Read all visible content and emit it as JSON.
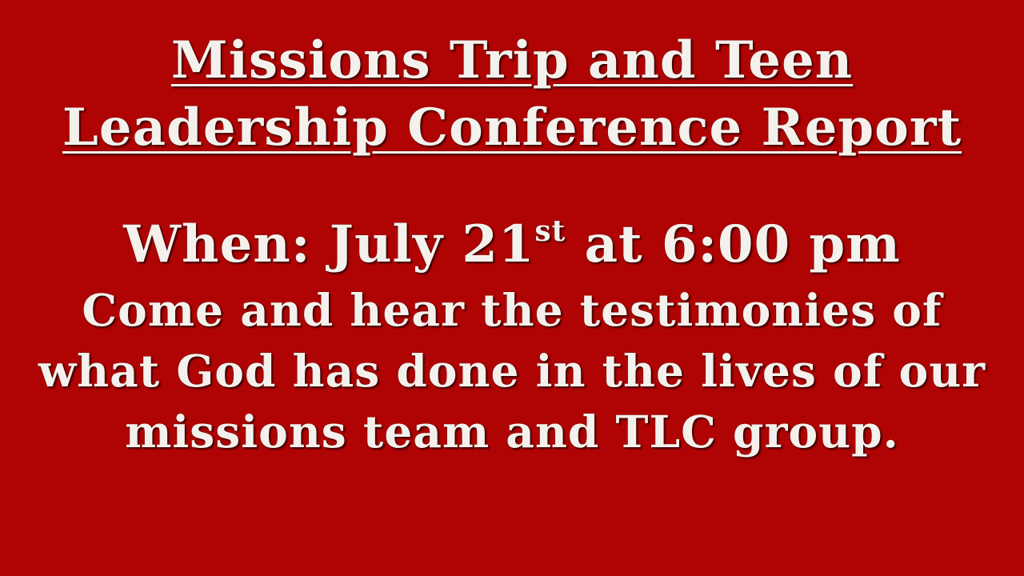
{
  "background_color": "#b00404",
  "text_color": "#f4f1ec",
  "title": {
    "line1": "Missions Trip and Teen",
    "line2": "Leadership Conference Report"
  },
  "when": {
    "prefix": "When: July 21",
    "superscript": "st",
    "suffix": " at 6:00 pm"
  },
  "description": {
    "line1": "Come and hear the testimonies of",
    "line2": "what God has done in the lives of our",
    "line3": "missions team and TLC group."
  }
}
